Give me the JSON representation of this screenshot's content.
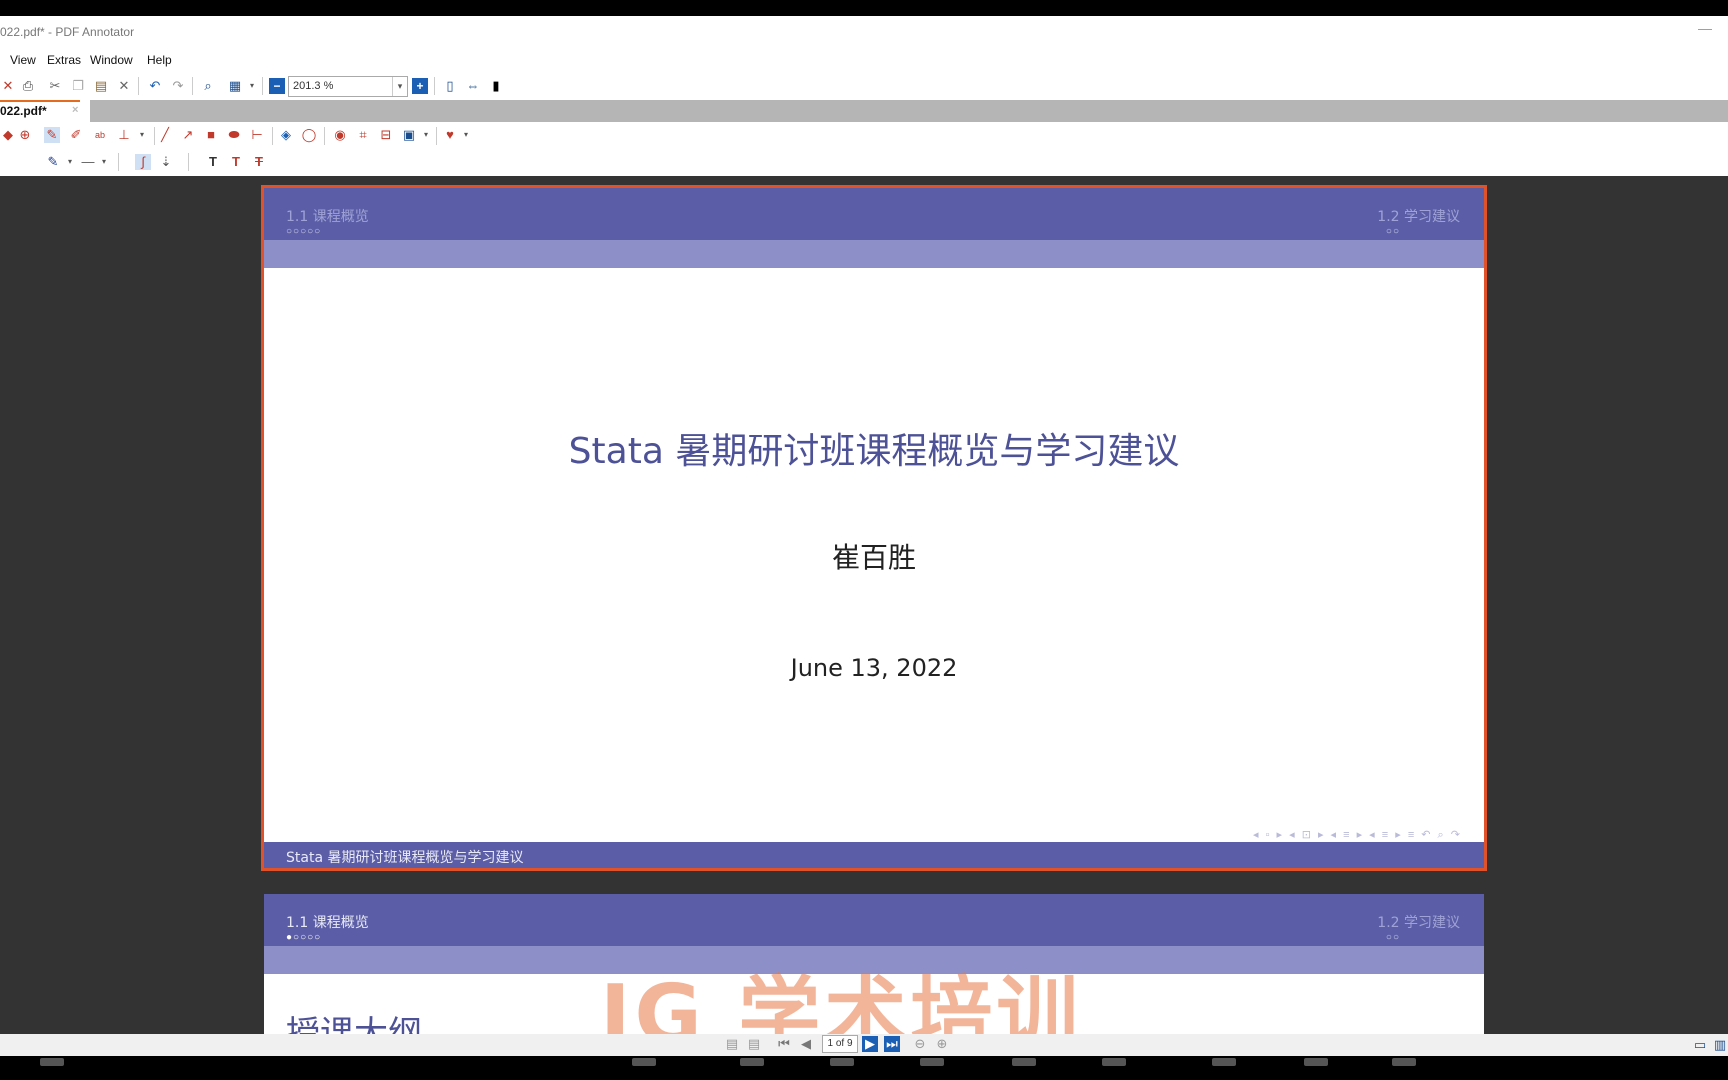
{
  "window": {
    "title": "022.pdf* - PDF Annotator",
    "minimize_glyph": "—"
  },
  "menu": [
    "View",
    "Extras",
    "Window",
    "Help"
  ],
  "toolbar": {
    "zoom_value": "201.3 %"
  },
  "tab": {
    "label": "022.pdf*",
    "close": "×"
  },
  "slides": [
    {
      "section_left": "1.1 课程概览",
      "dots_left": "○○○○○",
      "section_right": "1.2 学习建议",
      "dots_right": "○○",
      "title": "Stata 暑期研讨班课程概览与学习建议",
      "author": "崔百胜",
      "date": "June 13, 2022",
      "nav_symbols": "◂ ▫ ▸  ◂ ⊡ ▸  ◂ ≡ ▸  ◂ ≡ ▸   ≡   ↶ ⌕ ↷",
      "footer": "Stata 暑期研讨班课程概览与学习建议"
    },
    {
      "section_left": "1.1 课程概览",
      "dots_left": "●○○○○",
      "section_right": "1.2 学习建议",
      "dots_right": "○○",
      "heading": "授课大纲"
    }
  ],
  "watermark": "JG 学术培训",
  "page_nav": {
    "page_text": "1 of 9"
  },
  "colors": {
    "header": "#5b5ea6",
    "subheader": "#8d90c8",
    "selection": "#e0522a",
    "accent": "#e46c1f"
  }
}
